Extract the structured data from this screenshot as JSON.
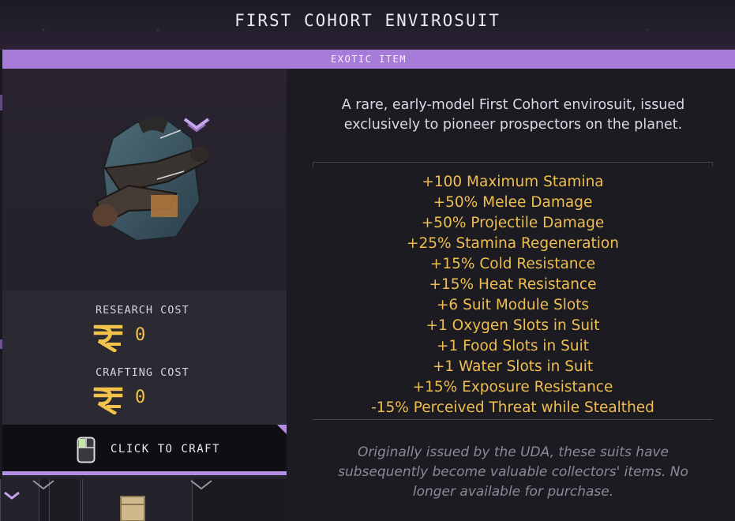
{
  "item": {
    "title": "FIRST COHORT ENVIROSUIT",
    "rarity": "EXOTIC ITEM",
    "description": "A rare, early-model First Cohort envirosuit, issued exclusively to pioneer prospectors on the planet.",
    "stats": [
      "+100 Maximum Stamina",
      "+50% Melee Damage",
      "+50% Projectile Damage",
      "+25% Stamina Regeneration",
      "+15% Cold Resistance",
      "+15% Heat Resistance",
      "+6 Suit Module Slots",
      "+1 Oxygen Slots in Suit",
      "+1 Food Slots in Suit",
      "+1 Water Slots in Suit",
      "+15% Exposure Resistance",
      "-15% Perceived Threat while Stealthed"
    ],
    "flavor": "Originally issued by the UDA, these suits have subsequently become valuable collectors' items. No longer available for purchase."
  },
  "costs": {
    "research_label": "RESEARCH COST",
    "research_value": "0",
    "crafting_label": "CRAFTING COST",
    "crafting_value": "0",
    "currency_icon": "rupee-currency-icon"
  },
  "actions": {
    "craft_label": "CLICK TO CRAFT",
    "craft_icon": "mouse-left-click-icon"
  },
  "colors": {
    "rarity_exotic": "#a77cd8",
    "stat_text": "#eebf4f",
    "currency": "#f2c24a"
  }
}
